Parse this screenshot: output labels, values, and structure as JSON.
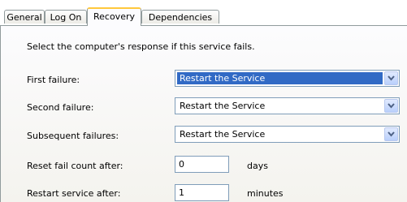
{
  "tabs": [
    {
      "label": "General",
      "active": false
    },
    {
      "label": "Log On",
      "active": false
    },
    {
      "label": "Recovery",
      "active": true
    },
    {
      "label": "Dependencies",
      "active": false
    }
  ],
  "recovery": {
    "intro": "Select the computer's response if this service fails.",
    "first_failure": {
      "label": "First failure:",
      "value": "Restart the Service"
    },
    "second_failure": {
      "label": "Second failure:",
      "value": "Restart the Service"
    },
    "subsequent_failures": {
      "label": "Subsequent failures:",
      "value": "Restart the Service"
    },
    "reset_count": {
      "label": "Reset fail count after:",
      "value": "0",
      "unit": "days"
    },
    "restart_service": {
      "label": "Restart service after:",
      "value": "1",
      "unit": "minutes"
    }
  },
  "colors": {
    "selection": "#316ac5",
    "tab_highlight": "#ffc83c",
    "border": "#7f9db9"
  },
  "icons": {
    "dropdown": "chevron-down-icon"
  }
}
